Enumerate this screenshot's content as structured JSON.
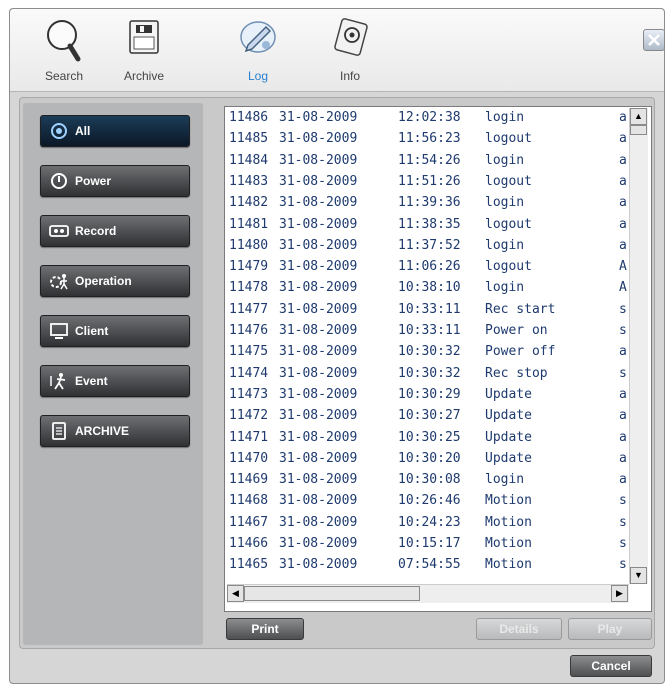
{
  "toolbar": {
    "tabs": [
      {
        "label": "Search",
        "icon": "magnifier-icon"
      },
      {
        "label": "Archive",
        "icon": "archive-icon"
      },
      {
        "label": "Log",
        "icon": "log-icon"
      },
      {
        "label": "Info",
        "icon": "info-icon"
      }
    ],
    "active_tab": "Log",
    "close_icon": "close-icon"
  },
  "categories": [
    {
      "label": "All",
      "icon": "all-icon",
      "active": true
    },
    {
      "label": "Power",
      "icon": "power-icon",
      "active": false
    },
    {
      "label": "Record",
      "icon": "record-icon",
      "active": false
    },
    {
      "label": "Operation",
      "icon": "operation-icon",
      "active": false
    },
    {
      "label": "Client",
      "icon": "client-icon",
      "active": false
    },
    {
      "label": "Event",
      "icon": "event-icon",
      "active": false
    },
    {
      "label": "ARCHIVE",
      "icon": "archive-doc-icon",
      "active": false
    }
  ],
  "log": {
    "rows": [
      {
        "id": "11486",
        "date": "31-08-2009",
        "time": "12:02:38",
        "event": "login",
        "user": "a"
      },
      {
        "id": "11485",
        "date": "31-08-2009",
        "time": "11:56:23",
        "event": "logout",
        "user": "a"
      },
      {
        "id": "11484",
        "date": "31-08-2009",
        "time": "11:54:26",
        "event": "login",
        "user": "a"
      },
      {
        "id": "11483",
        "date": "31-08-2009",
        "time": "11:51:26",
        "event": "logout",
        "user": "a"
      },
      {
        "id": "11482",
        "date": "31-08-2009",
        "time": "11:39:36",
        "event": "login",
        "user": "a"
      },
      {
        "id": "11481",
        "date": "31-08-2009",
        "time": "11:38:35",
        "event": "logout",
        "user": "a"
      },
      {
        "id": "11480",
        "date": "31-08-2009",
        "time": "11:37:52",
        "event": "login",
        "user": "a"
      },
      {
        "id": "11479",
        "date": "31-08-2009",
        "time": "11:06:26",
        "event": "logout",
        "user": "A"
      },
      {
        "id": "11478",
        "date": "31-08-2009",
        "time": "10:38:10",
        "event": "login",
        "user": "A"
      },
      {
        "id": "11477",
        "date": "31-08-2009",
        "time": "10:33:11",
        "event": "Rec start",
        "user": "s"
      },
      {
        "id": "11476",
        "date": "31-08-2009",
        "time": "10:33:11",
        "event": "Power on",
        "user": "s"
      },
      {
        "id": "11475",
        "date": "31-08-2009",
        "time": "10:30:32",
        "event": "Power off",
        "user": "a"
      },
      {
        "id": "11474",
        "date": "31-08-2009",
        "time": "10:30:32",
        "event": "Rec stop",
        "user": "s"
      },
      {
        "id": "11473",
        "date": "31-08-2009",
        "time": "10:30:29",
        "event": "Update",
        "user": "a"
      },
      {
        "id": "11472",
        "date": "31-08-2009",
        "time": "10:30:27",
        "event": "Update",
        "user": "a"
      },
      {
        "id": "11471",
        "date": "31-08-2009",
        "time": "10:30:25",
        "event": "Update",
        "user": "a"
      },
      {
        "id": "11470",
        "date": "31-08-2009",
        "time": "10:30:20",
        "event": "Update",
        "user": "a"
      },
      {
        "id": "11469",
        "date": "31-08-2009",
        "time": "10:30:08",
        "event": "login",
        "user": "a"
      },
      {
        "id": "11468",
        "date": "31-08-2009",
        "time": "10:26:46",
        "event": "Motion",
        "user": "s"
      },
      {
        "id": "11467",
        "date": "31-08-2009",
        "time": "10:24:23",
        "event": "Motion",
        "user": "s"
      },
      {
        "id": "11466",
        "date": "31-08-2009",
        "time": "10:15:17",
        "event": "Motion",
        "user": "s"
      },
      {
        "id": "11465",
        "date": "31-08-2009",
        "time": "07:54:55",
        "event": "Motion",
        "user": "s"
      }
    ]
  },
  "buttons": {
    "print": "Print",
    "details": "Details",
    "play": "Play",
    "cancel": "Cancel"
  },
  "colors": {
    "row_text": "#1e3a6e",
    "active_tab_text": "#2a7fcf",
    "category_bg": "#3f4143",
    "category_active_bg": "#13283c"
  }
}
